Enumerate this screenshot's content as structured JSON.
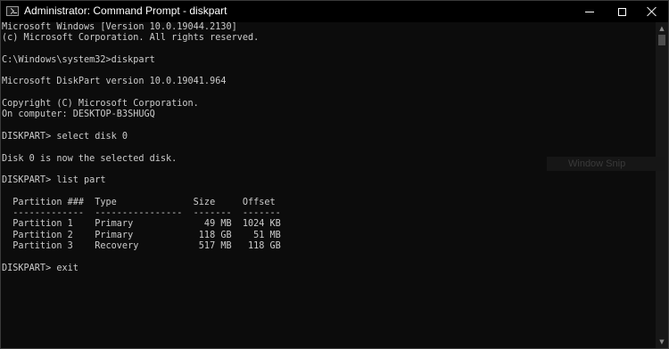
{
  "window": {
    "title": "Administrator: Command Prompt - diskpart",
    "icon": "terminal-icon",
    "controls": [
      "minimize-icon",
      "maximize-icon",
      "close-icon"
    ]
  },
  "console": {
    "lines": [
      "Microsoft Windows [Version 10.0.19044.2130]",
      "(c) Microsoft Corporation. All rights reserved.",
      "",
      "C:\\Windows\\system32>diskpart",
      "",
      "Microsoft DiskPart version 10.0.19041.964",
      "",
      "Copyright (C) Microsoft Corporation.",
      "On computer: DESKTOP-B3SHUGQ",
      "",
      "DISKPART> select disk 0",
      "",
      "Disk 0 is now the selected disk.",
      "",
      "DISKPART> list part",
      "",
      "  Partition ###  Type              Size     Offset",
      "  -------------  ----------------  -------  -------",
      "  Partition 1    Primary             49 MB  1024 KB",
      "  Partition 2    Primary            118 GB    51 MB",
      "  Partition 3    Recovery           517 MB   118 GB",
      "",
      "DISKPART> exit"
    ],
    "colors": {
      "background": "#0c0c0c",
      "text": "#cccccc"
    }
  },
  "overlay": {
    "text": "Window Snip"
  },
  "scrollbar": {
    "up_icon": "scroll-up-arrow-icon",
    "down_icon": "scroll-down-arrow-icon"
  }
}
